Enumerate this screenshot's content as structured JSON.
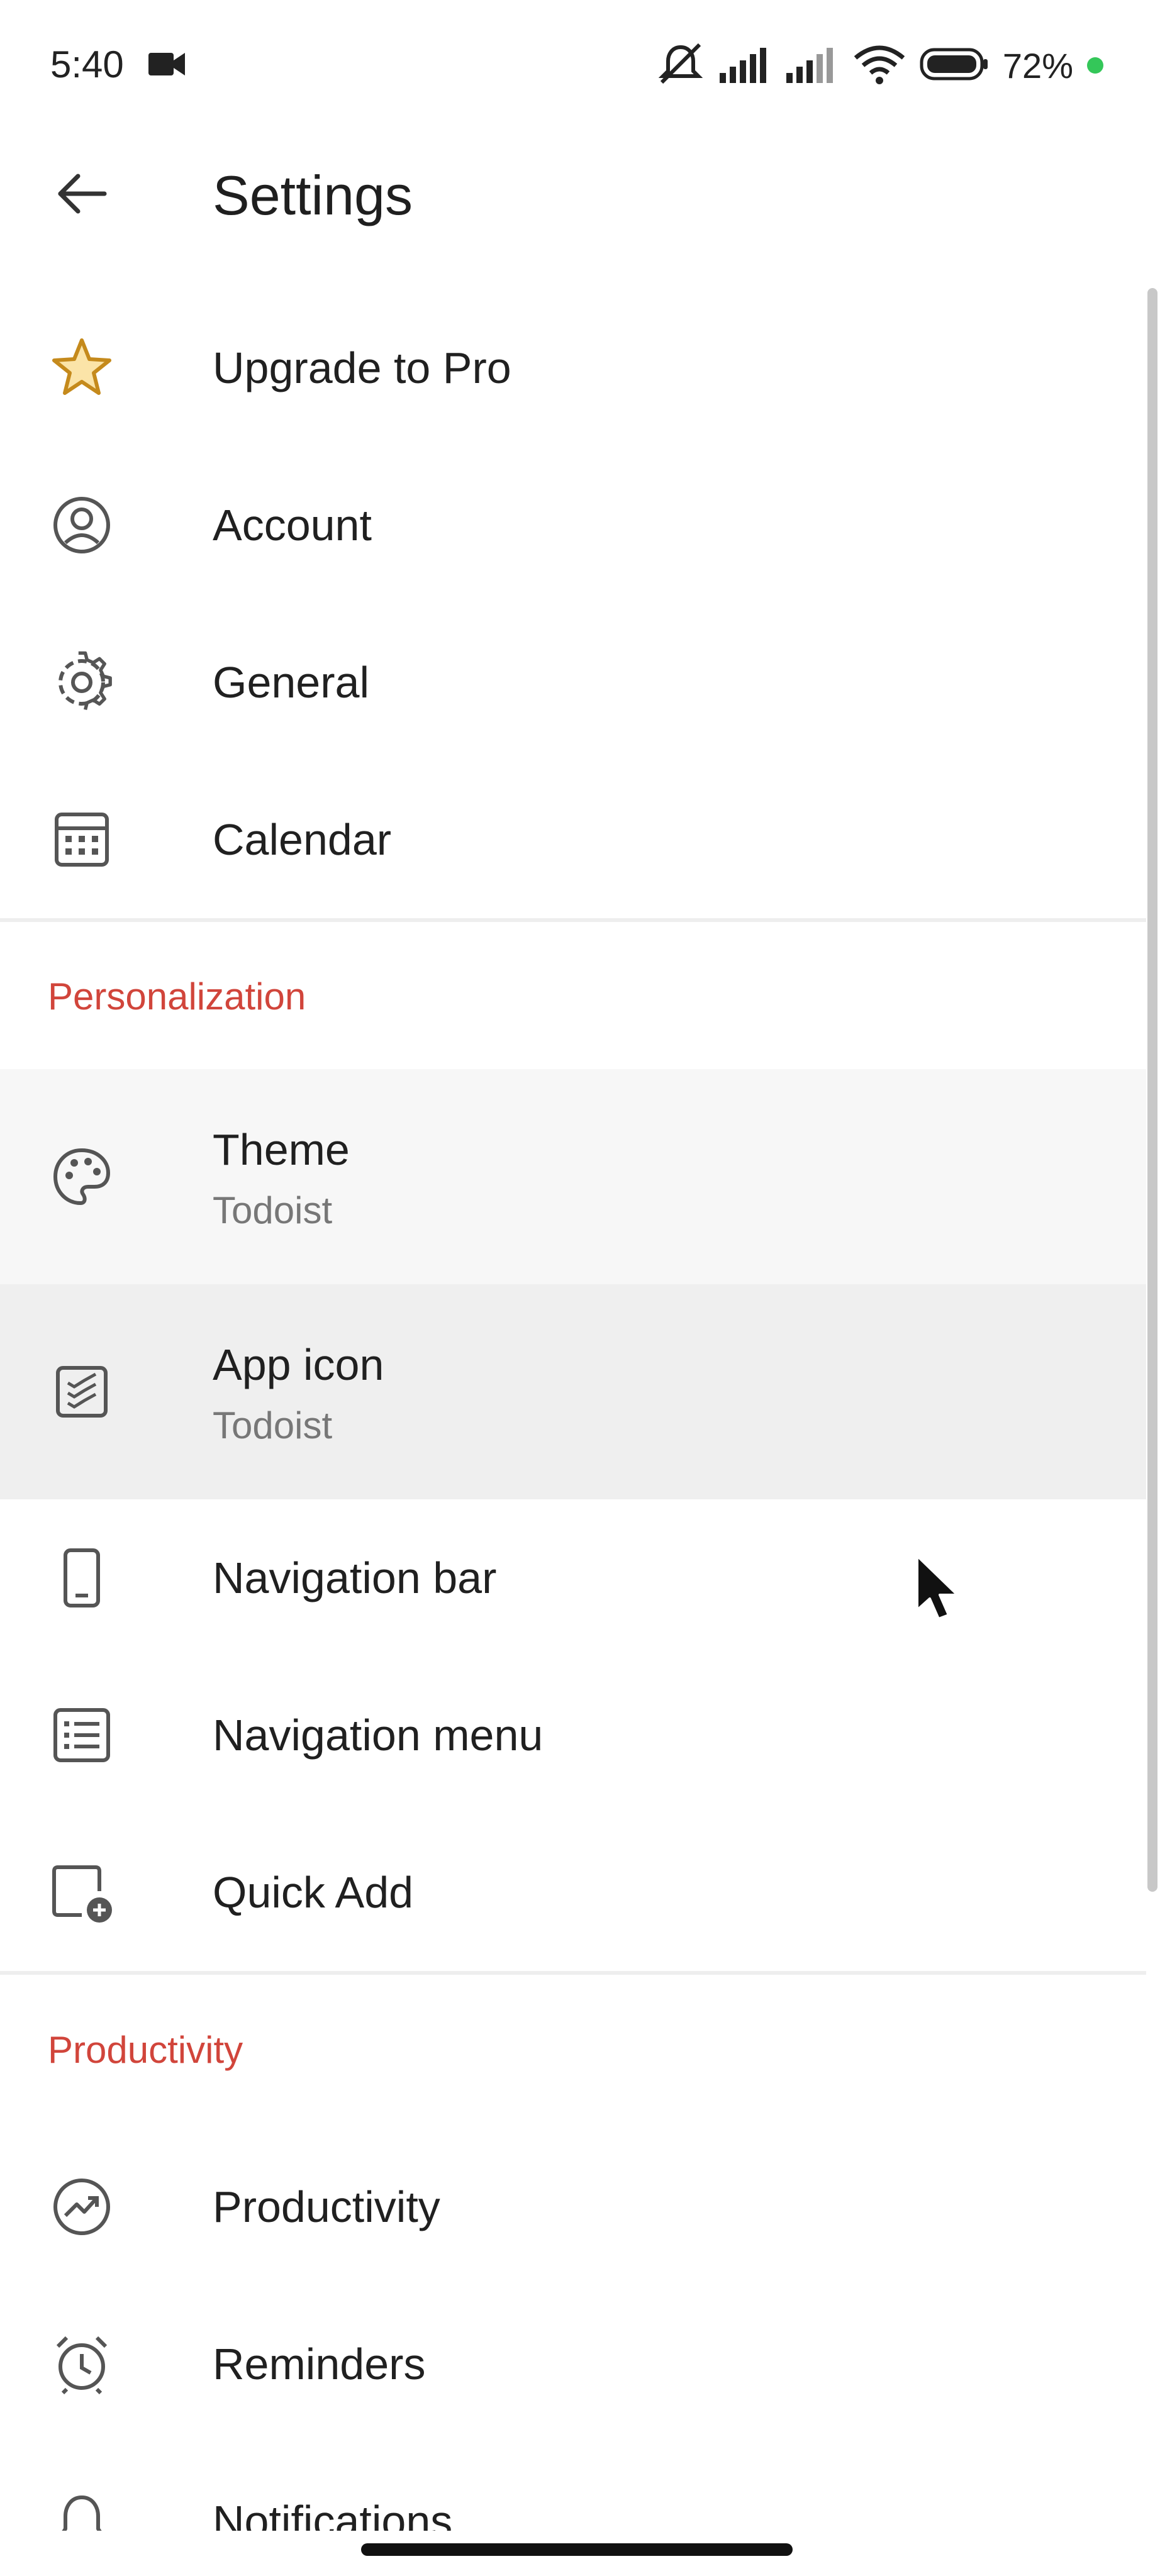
{
  "status_bar": {
    "time": "5:40",
    "battery_text": "72%",
    "icons": [
      "video-camera-icon",
      "mute-vibrate-icon",
      "signal-icon",
      "signal-icon",
      "wifi-icon",
      "battery-icon"
    ]
  },
  "app_bar": {
    "back_icon": "arrow-left-icon",
    "title": "Settings"
  },
  "items": [
    {
      "label": "Upgrade to Pro",
      "icon": "star-icon"
    },
    {
      "label": "Account",
      "icon": "account-circle-icon"
    },
    {
      "label": "General",
      "icon": "gear-icon"
    },
    {
      "label": "Calendar",
      "icon": "calendar-icon"
    }
  ],
  "sections": {
    "personalization": "Personalization",
    "productivity": "Productivity"
  },
  "personalization_items": [
    {
      "label": "Theme",
      "value": "Todoist",
      "icon": "palette-icon"
    },
    {
      "label": "App icon",
      "value": "Todoist",
      "icon": "app-icon-icon"
    },
    {
      "label": "Navigation bar",
      "icon": "phone-icon"
    },
    {
      "label": "Navigation menu",
      "icon": "list-icon"
    },
    {
      "label": "Quick Add",
      "icon": "quick-add-icon"
    }
  ],
  "productivity_items": [
    {
      "label": "Productivity",
      "icon": "trend-icon"
    },
    {
      "label": "Reminders",
      "icon": "alarm-icon"
    },
    {
      "label": "Notifications",
      "icon": "bell-icon"
    }
  ],
  "colors": {
    "accent": "#d1453b",
    "star": "#c58a1c",
    "highlight_theme": "#f7f7f7",
    "highlight_app_icon": "#efefef"
  }
}
